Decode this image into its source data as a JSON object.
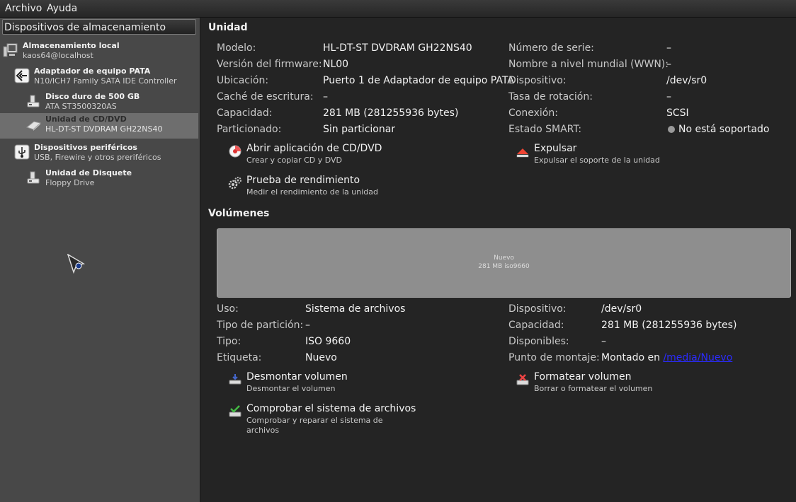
{
  "menubar": {
    "items": [
      "Archivo",
      "Ayuda"
    ]
  },
  "sidebar": {
    "header": "Dispositivos de almacenamiento",
    "items": [
      {
        "title": "Almacenamiento local",
        "subtitle": "kaos64@localhost",
        "icon": "computer-icon"
      },
      {
        "title": "Adaptador de equipo PATA",
        "subtitle": "N10/ICH7 Family SATA IDE Controller",
        "icon": "controller-icon"
      },
      {
        "title": "Disco duro de 500 GB",
        "subtitle": "ATA ST3500320AS",
        "icon": "hard-disk-icon"
      },
      {
        "title": "Unidad de CD/DVD",
        "subtitle": "HL-DT-ST DVDRAM GH22NS40",
        "icon": "optical-drive-icon",
        "selected": true
      },
      {
        "title": "Dispositivos periféricos",
        "subtitle": "USB, Firewire y otros preriféricos",
        "icon": "usb-icon"
      },
      {
        "title": "Unidad de Disquete",
        "subtitle": "Floppy Drive",
        "icon": "floppy-drive-icon"
      }
    ]
  },
  "unidad": {
    "title": "Unidad",
    "left": [
      {
        "label": "Modelo:",
        "value": "HL-DT-ST DVDRAM GH22NS40"
      },
      {
        "label": "Versión del firmware:",
        "value": "NL00"
      },
      {
        "label": "Ubicación:",
        "value": "Puerto 1 de Adaptador de equipo PATA"
      },
      {
        "label": "Caché de escritura:",
        "value": "–"
      },
      {
        "label": "Capacidad:",
        "value": "281 MB (281255936 bytes)"
      },
      {
        "label": "Particionado:",
        "value": "Sin particionar"
      }
    ],
    "right": [
      {
        "label": "Número de serie:",
        "value": "–"
      },
      {
        "label": "Nombre a nivel mundial (WWN):",
        "value": "–"
      },
      {
        "label": "Dispositivo:",
        "value": "/dev/sr0"
      },
      {
        "label": "Tasa de rotación:",
        "value": "–"
      },
      {
        "label": "Conexión:",
        "value": "SCSI"
      },
      {
        "label": "Estado SMART:",
        "value": "No está soportado"
      }
    ],
    "actions": [
      {
        "title": "Abrir aplicación de CD/DVD",
        "subtitle": "Crear y copiar CD y DVD"
      },
      {
        "title": "Expulsar",
        "subtitle": "Expulsar el soporte de la unidad"
      },
      {
        "title": "Prueba de rendimiento",
        "subtitle": "Medir el rendimiento de la unidad"
      }
    ]
  },
  "volumenes": {
    "title": "Volúmenes",
    "bar_label": "Nuevo",
    "bar_sublabel": "281 MB iso9660",
    "left": [
      {
        "label": "Uso:",
        "value": "Sistema de archivos"
      },
      {
        "label": "Tipo de partición:",
        "value": "–"
      },
      {
        "label": "Tipo:",
        "value": "ISO 9660"
      },
      {
        "label": "Etiqueta:",
        "value": "Nuevo"
      }
    ],
    "right": [
      {
        "label": "Dispositivo:",
        "value": "/dev/sr0"
      },
      {
        "label": "Capacidad:",
        "value": "281 MB (281255936 bytes)"
      },
      {
        "label": "Disponibles:",
        "value": "–"
      },
      {
        "label": "Punto de montaje:",
        "value": "Montado en",
        "link": "/media/Nuevo"
      }
    ],
    "actions": [
      {
        "title": "Desmontar volumen",
        "subtitle": "Desmontar el volumen"
      },
      {
        "title": "Formatear volumen",
        "subtitle": "Borrar o formatear el volumen"
      },
      {
        "title": "Comprobar el sistema de archivos",
        "subtitle": "Comprobar y reparar el sistema de archivos"
      }
    ]
  },
  "colors": {
    "background": "#242424",
    "sidebar": "#484848",
    "selection": "#6e6e6e",
    "link": "#2b2bff"
  }
}
